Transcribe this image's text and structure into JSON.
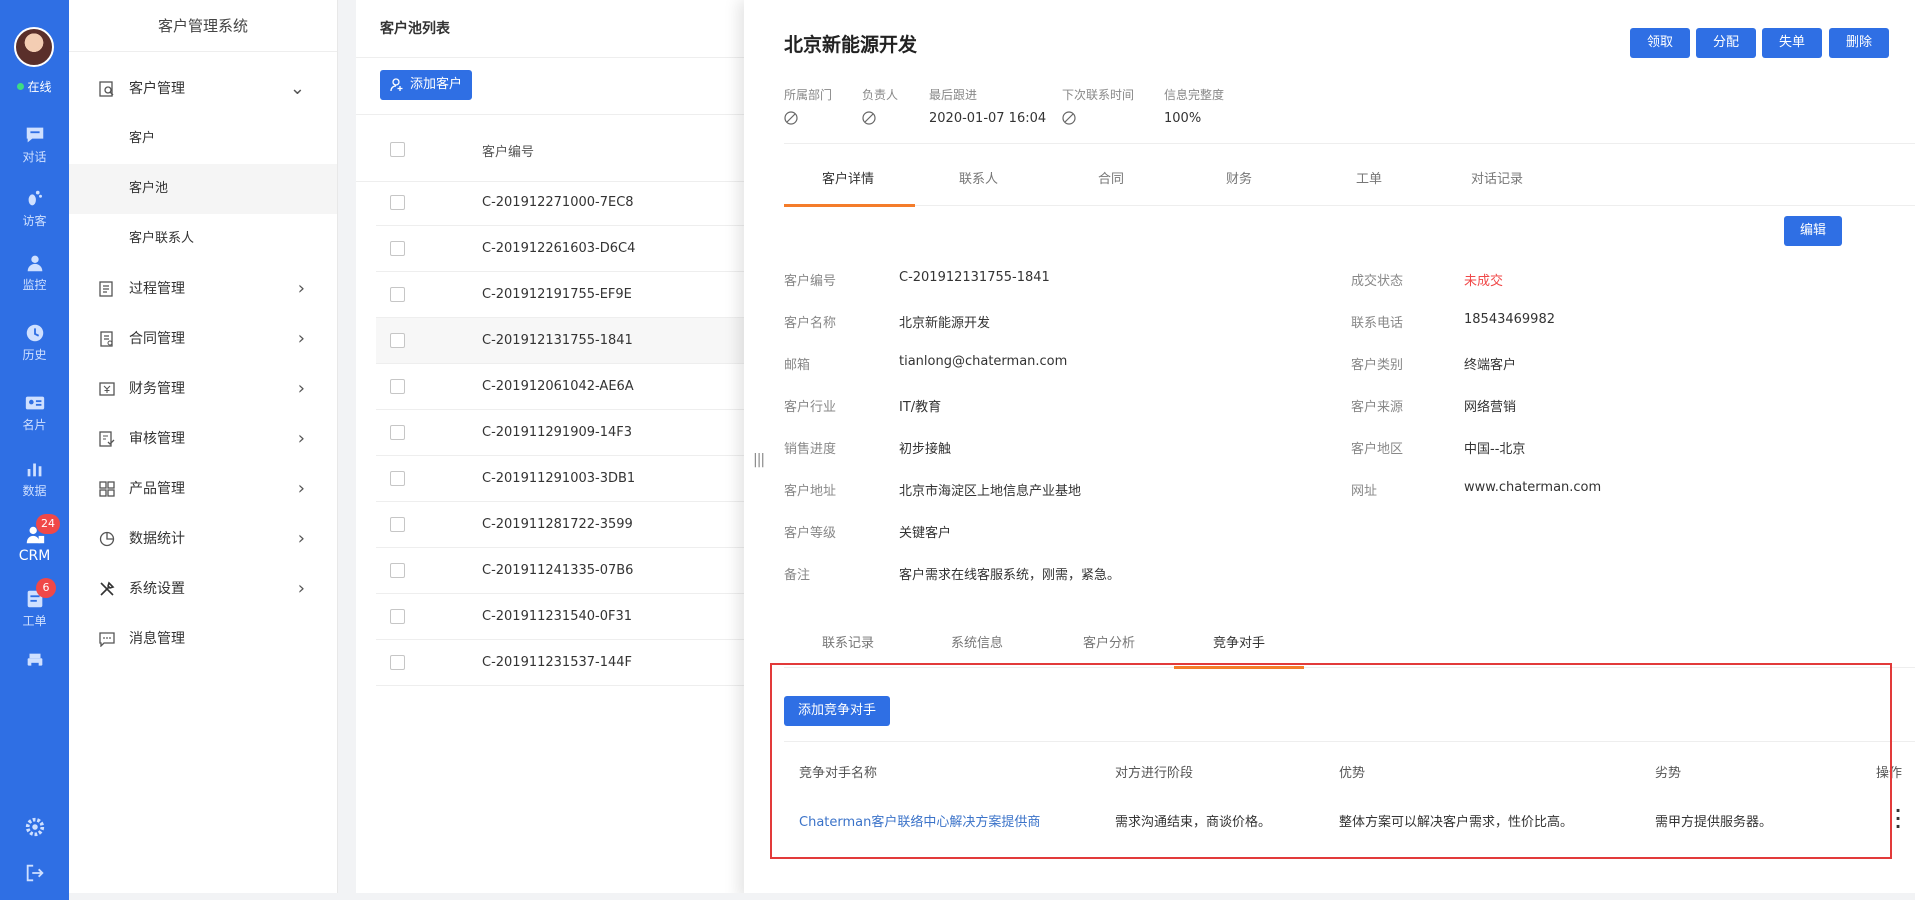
{
  "rail": {
    "status": "在线",
    "items": [
      {
        "label": "对话",
        "icon": "chat-icon"
      },
      {
        "label": "访客",
        "icon": "footprint-icon"
      },
      {
        "label": "监控",
        "icon": "monitor-user-icon"
      },
      {
        "label": "历史",
        "icon": "clock-icon"
      },
      {
        "label": "名片",
        "icon": "card-icon"
      },
      {
        "label": "数据",
        "icon": "bar-chart-icon"
      },
      {
        "label": "CRM",
        "icon": "crm-icon",
        "badge": "24"
      },
      {
        "label": "工单",
        "icon": "ticket-icon",
        "badge": "6"
      }
    ],
    "bottom": [
      "settings-icon",
      "logout-icon"
    ]
  },
  "menu": {
    "title": "客户管理系统",
    "group_customer": "客户管理",
    "sub": [
      "客户",
      "客户池",
      "客户联系人"
    ],
    "groups": [
      "过程管理",
      "合同管理",
      "财务管理",
      "审核管理",
      "产品管理",
      "数据统计",
      "系统设置",
      "消息管理"
    ]
  },
  "list": {
    "title": "客户池列表",
    "add_label": "添加客户",
    "col_id": "客户编号",
    "rows": [
      "C-201912271000-7EC8",
      "C-201912261603-D6C4",
      "C-201912191755-EF9E",
      "C-201912131755-1841",
      "C-201912061042-AE6A",
      "C-201911291909-14F3",
      "C-201911291003-3DB1",
      "C-201911281722-3599",
      "C-201911241335-07B6",
      "C-201911231540-0F31",
      "C-201911231537-144F"
    ]
  },
  "detail": {
    "title": "北京新能源开发",
    "actions": [
      "领取",
      "分配",
      "失单",
      "删除"
    ],
    "meta": {
      "dept_label": "所属部门",
      "owner_label": "负责人",
      "last_label": "最后跟进",
      "last_value": "2020-01-07 16:04",
      "next_label": "下次联系时间",
      "complete_label": "信息完整度",
      "complete_value": "100%"
    },
    "tabs": [
      "客户详情",
      "联系人",
      "合同",
      "财务",
      "工单",
      "对话记录"
    ],
    "edit_label": "编辑",
    "fields_left": [
      {
        "label": "客户编号",
        "value": "C-201912131755-1841"
      },
      {
        "label": "客户名称",
        "value": "北京新能源开发"
      },
      {
        "label": "邮箱",
        "value": "tianlong@chaterman.com"
      },
      {
        "label": "客户行业",
        "value": "IT/教育"
      },
      {
        "label": "销售进度",
        "value": "初步接触"
      },
      {
        "label": "客户地址",
        "value": "北京市海淀区上地信息产业基地"
      },
      {
        "label": "客户等级",
        "value": "关键客户"
      },
      {
        "label": "备注",
        "value": "客户需求在线客服系统，刚需，紧急。"
      }
    ],
    "fields_right": [
      {
        "label": "成交状态",
        "value": "未成交"
      },
      {
        "label": "联系电话",
        "value": "18543469982"
      },
      {
        "label": "客户类别",
        "value": "终端客户"
      },
      {
        "label": "客户来源",
        "value": "网络营销"
      },
      {
        "label": "客户地区",
        "value": "中国--北京"
      },
      {
        "label": "网址",
        "value": "www.chaterman.com"
      }
    ],
    "tabs2": [
      "联系记录",
      "系统信息",
      "客户分析",
      "竞争对手"
    ],
    "competitor": {
      "add_label": "添加竞争对手",
      "headers": [
        "竞争对手名称",
        "对方进行阶段",
        "优势",
        "劣势",
        "操作"
      ],
      "row": [
        "Chaterman客户联络中心解决方案提供商",
        "需求沟通结束，商谈价格。",
        "整体方案可以解决客户需求，性价比高。",
        "需甲方提供服务器。"
      ]
    }
  },
  "colors": {
    "primary": "#2f6fe4",
    "accent": "#f47c2a",
    "danger": "#f04848",
    "highlight_box": "#e23a3a"
  }
}
